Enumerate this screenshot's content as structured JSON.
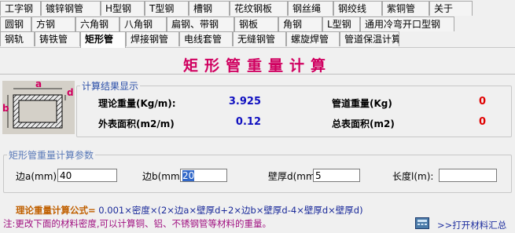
{
  "tabs": {
    "row1": [
      "工字钢",
      "镀锌钢管",
      "H型钢",
      "T型钢",
      "槽钢",
      "花纹钢板",
      "钢丝绳",
      "钢绞线",
      "紫铜管",
      "关于"
    ],
    "row2": [
      "圆钢",
      "方钢",
      "六角钢",
      "八角钢",
      "扁钢、带钢",
      "钢板",
      "角钢",
      "L型钢",
      "通用冷弯开口型钢"
    ],
    "row3": [
      "钢轨",
      "铸铁管",
      "矩形管",
      "焊接钢管",
      "电线套管",
      "无缝钢管",
      "螺旋焊管",
      "管道保温计算"
    ],
    "selected": "矩形管"
  },
  "title": "矩形管重量计算",
  "diagram": {
    "label_a": "a",
    "label_b": "b",
    "label_d": "d"
  },
  "results": {
    "legend": "计算结果显示",
    "theory_weight_label": "理论重量(Kg/m):",
    "theory_weight_value": "3.925",
    "pipe_weight_label": "管道重量(Kg)",
    "pipe_weight_value": "0",
    "outer_area_label": "外表面积(m2/m)",
    "outer_area_value": "0.12",
    "total_area_label": "总表面积(m2)",
    "total_area_value": "0",
    "colors": {
      "theory": "#1010c0",
      "pipe": "#e00000",
      "outer": "#1010c0",
      "total": "#e00000"
    }
  },
  "params": {
    "legend": "矩形管重量计算参数",
    "side_a_label": "边a(mm):",
    "side_a_value": "40",
    "side_b_label": "边b(mm):",
    "side_b_value": "20",
    "thickness_label": "壁厚d(mm):",
    "thickness_value": "5",
    "length_label": "长度l(m):",
    "length_value": ""
  },
  "formula": {
    "label": "理论重量计算公式=",
    "expr": " 0.001×密度×(2×边a×壁厚d+2×边b×壁厚d-4×壁厚d×壁厚d)",
    "label_color": "#c06000",
    "expr_color": "#1a2a9a"
  },
  "note": "注:更改下面的材料密度,可以计算铜、铝、不锈钢管等材料的重量。",
  "link": ">>打开材料汇总",
  "calc_icon": "calculator-icon"
}
